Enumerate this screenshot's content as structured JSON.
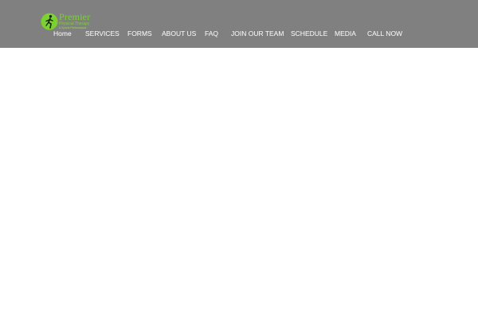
{
  "logo": {
    "name": "Premier",
    "subtitle": "Physical Therapy",
    "tagline": "& Sports Performance",
    "accent": "#7ad32a",
    "icon": "runner-icon"
  },
  "header": {
    "background": "#808080"
  },
  "nav": {
    "items": [
      {
        "label": "Home"
      },
      {
        "label": "SERVICES"
      },
      {
        "label": "FORMS"
      },
      {
        "label": "ABOUT US"
      },
      {
        "label": "FAQ"
      },
      {
        "label": "JOIN OUR TEAM"
      },
      {
        "label": "SCHEDULE"
      },
      {
        "label": "MEDIA"
      },
      {
        "label": "CALL NOW"
      }
    ]
  }
}
